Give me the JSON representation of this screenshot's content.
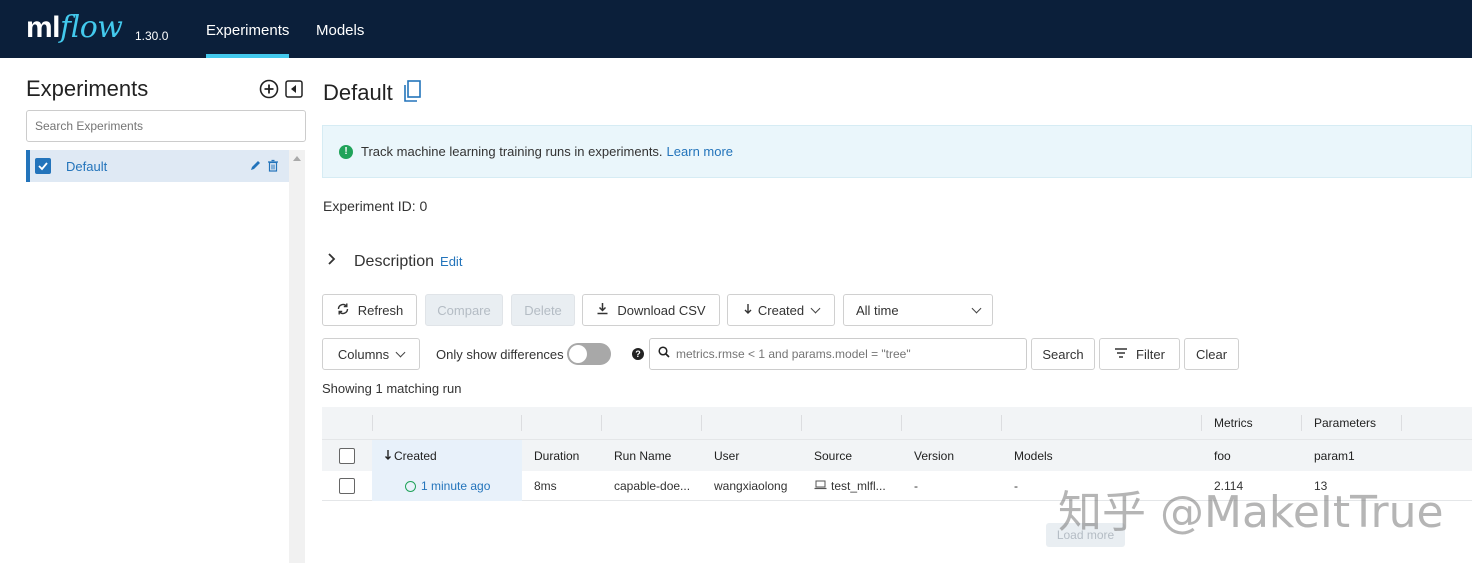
{
  "header": {
    "logo_ml": "ml",
    "logo_flow": "flow",
    "version": "1.30.0",
    "tabs": [
      {
        "label": "Experiments",
        "active": true
      },
      {
        "label": "Models",
        "active": false
      }
    ]
  },
  "sidebar": {
    "title": "Experiments",
    "search_placeholder": "Search Experiments",
    "items": [
      {
        "label": "Default",
        "checked": true
      }
    ]
  },
  "main": {
    "title": "Default",
    "banner_text": "Track machine learning training runs in experiments.",
    "banner_link": "Learn more",
    "experiment_id": "Experiment ID:  0",
    "description_label": "Description",
    "description_edit": "Edit",
    "toolbar": {
      "refresh": "Refresh",
      "compare": "Compare",
      "delete": "Delete",
      "download_csv": "Download CSV",
      "sort_label": "Created",
      "time_label": "All time",
      "columns": "Columns",
      "only_diff": "Only show differences",
      "search_placeholder": "metrics.rmse < 1 and params.model = \"tree\"",
      "search": "Search",
      "filter": "Filter",
      "clear": "Clear"
    },
    "showing": "Showing 1 matching run",
    "table": {
      "group_headers": {
        "metrics": "Metrics",
        "parameters": "Parameters"
      },
      "columns": [
        "Created",
        "Duration",
        "Run Name",
        "User",
        "Source",
        "Version",
        "Models",
        "foo",
        "param1"
      ],
      "rows": [
        {
          "created": "1 minute ago",
          "duration": "8ms",
          "run_name": "capable-doe...",
          "user": "wangxiaolong",
          "source": "test_mlfl...",
          "version": "-",
          "models": "-",
          "foo": "2.114",
          "param1": "13"
        }
      ]
    },
    "load_more": "Load more"
  },
  "watermark": "知乎 @MakeItTrue",
  "colors": {
    "topbar": "#0b1f3a",
    "accent": "#43c9ed",
    "link": "#2374bb",
    "success": "#20a35a"
  }
}
